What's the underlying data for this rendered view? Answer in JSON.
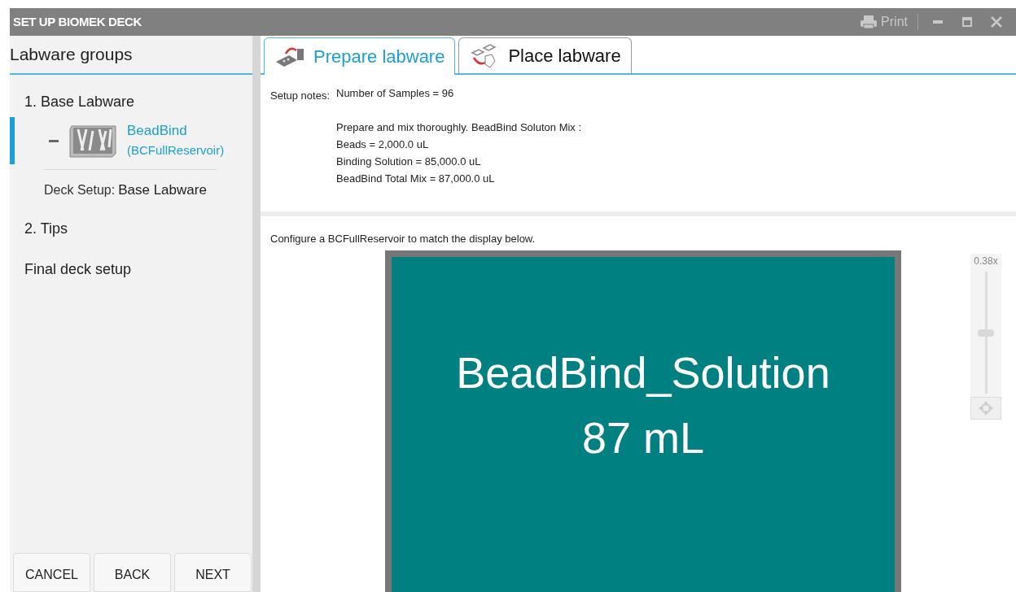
{
  "window": {
    "title": "SET UP BIOMEK DECK",
    "print": "Print"
  },
  "sidebar": {
    "title": "Labware groups",
    "items": [
      {
        "label": "1. Base Labware",
        "selected": false,
        "children": [
          {
            "name": "BeadBind",
            "type": "(BCFullReservoir)",
            "selected": true
          }
        ],
        "deck_setup": {
          "label": "Deck Setup:",
          "value": "Base Labware"
        }
      },
      {
        "label": "2. Tips",
        "selected": false
      },
      {
        "label": "Final deck setup",
        "selected": false
      }
    ],
    "buttons": [
      "CANCEL",
      "BACK",
      "NEXT"
    ]
  },
  "tabs": [
    {
      "label": "Prepare labware",
      "selected": true
    },
    {
      "label": "Place labware",
      "selected": false
    }
  ],
  "setup_notes": {
    "label": "Setup notes:",
    "summary": "Number of Samples =  96",
    "lines": [
      "Prepare and mix thoroughly. BeadBind Soluton Mix :",
      "Beads = 2,000.0  uL",
      "Binding Solution = 85,000.0  uL",
      "BeadBind Total Mix = 87,000.0  uL"
    ]
  },
  "instruction": "Configure a BCFullReservoir to match the display below.",
  "reservoir": {
    "name": "BeadBind_Solution",
    "volume": "87 mL",
    "color": "#008080"
  },
  "zoom": {
    "reading": "0.38x",
    "level": 0.5
  }
}
